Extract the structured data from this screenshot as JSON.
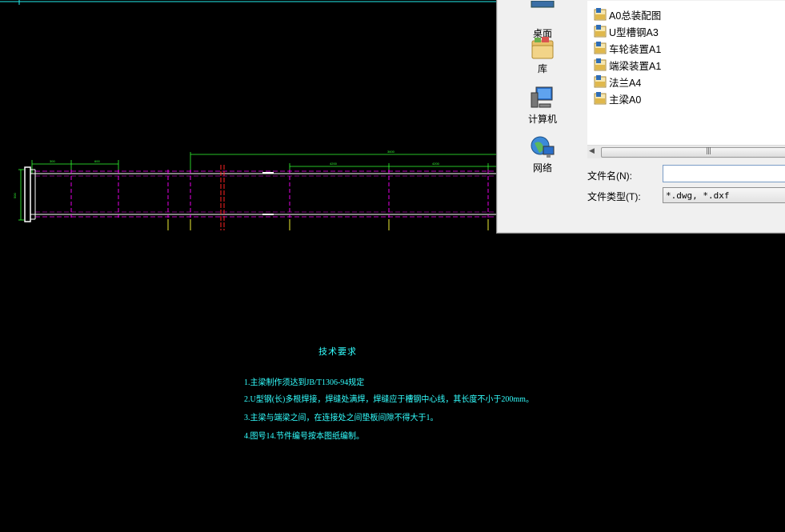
{
  "drawing": {
    "dims": {
      "d1": "300",
      "d2": "600",
      "d3": "3600",
      "d4": "1/2/3/4",
      "d5": "4200",
      "d6": "4200",
      "d7": "500"
    },
    "notes": {
      "title": "技术要求",
      "lines": [
        "1.主梁制作须达到JB/T1306-94规定",
        "2.U型钢(长)多根焊接，焊缝处满焊，焊缝应于槽钢中心线，其长度不小于200mm。",
        "3.主梁与端梁之间，在连接处之间垫板间隙不得大于1。",
        "4.图号14.节件编号按本图纸编制。"
      ]
    }
  },
  "dialog": {
    "places": [
      {
        "label": "桌面",
        "icon": "desktop-icon"
      },
      {
        "label": "库",
        "icon": "library-icon"
      },
      {
        "label": "计算机",
        "icon": "computer-icon"
      },
      {
        "label": "网络",
        "icon": "network-icon"
      }
    ],
    "files": [
      "A0总装配图",
      "U型槽钢A3",
      "车轮装置A1",
      "端梁装置A1",
      "法兰A4",
      "主梁A0"
    ],
    "filename_label": "文件名(N):",
    "filename_value": "",
    "filetype_label": "文件类型(T):",
    "filetype_value": "*.dwg, *.dxf",
    "scroll_grip": "|||"
  }
}
